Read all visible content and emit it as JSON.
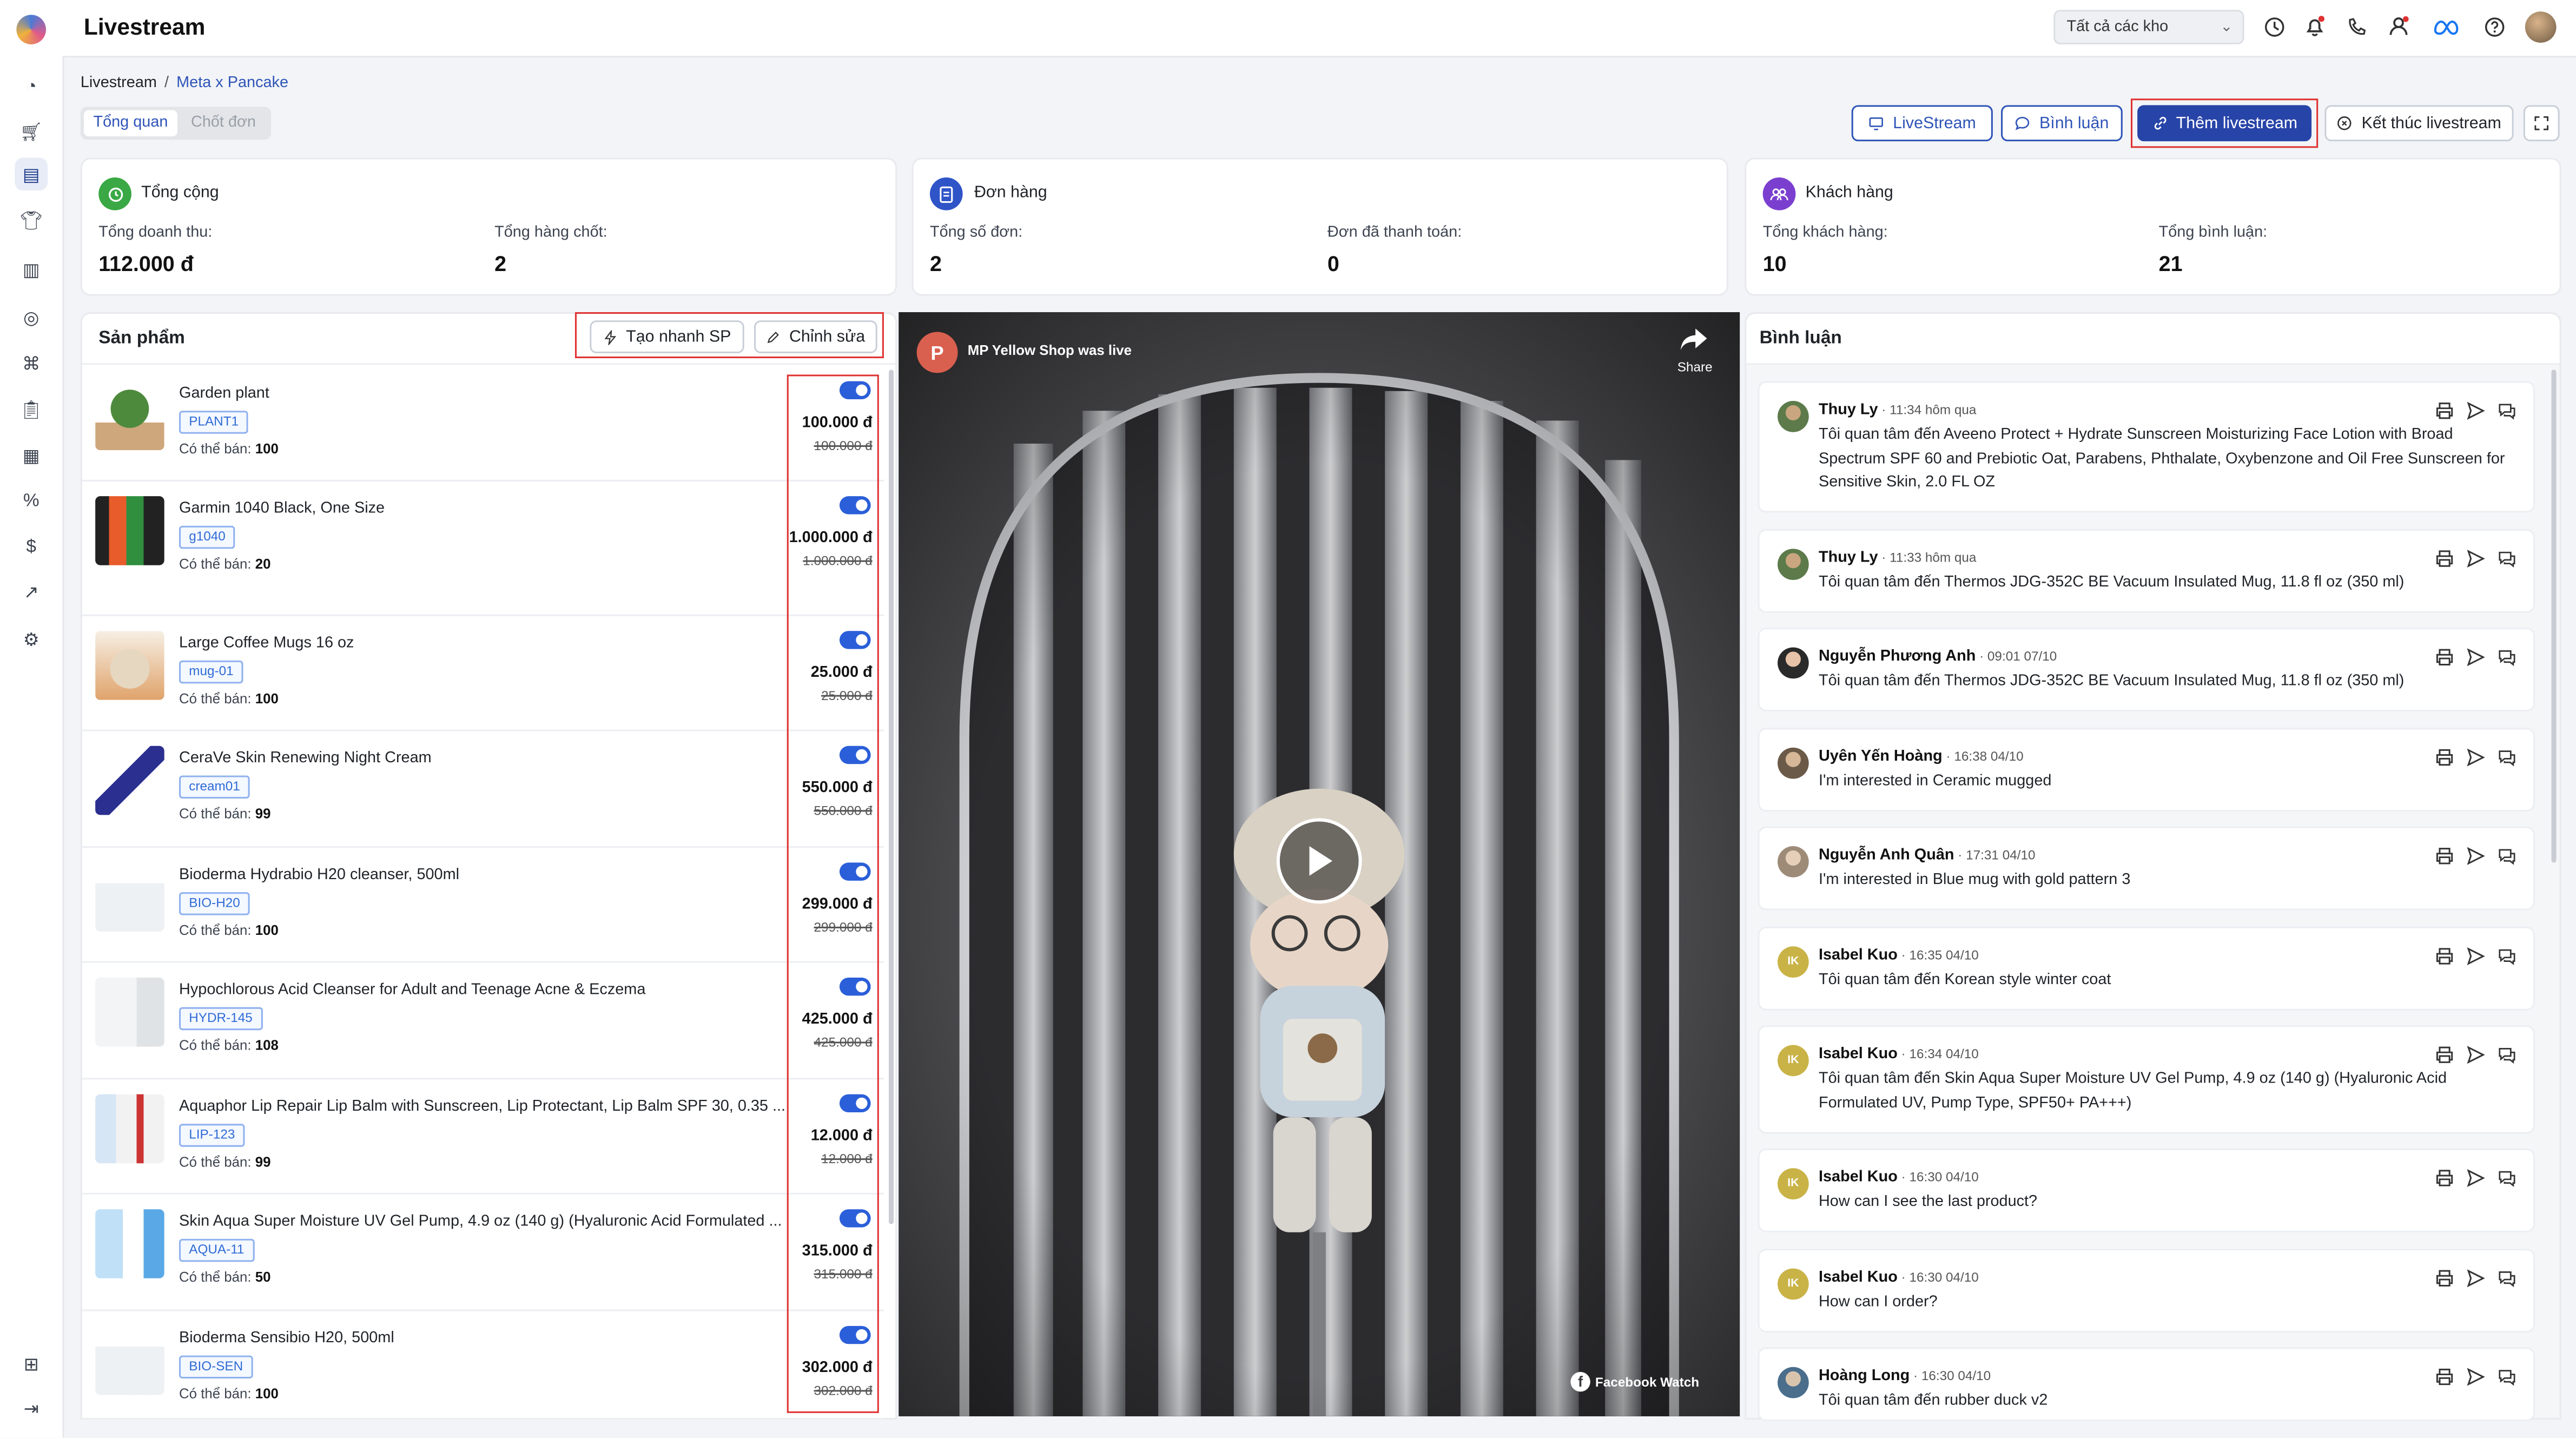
{
  "app": {
    "title": "Livestream"
  },
  "header": {
    "warehouse_select": "Tất cả các kho"
  },
  "breadcrumb": {
    "root": "Livestream",
    "separator": "/",
    "current": "Meta x Pancake"
  },
  "tabs": [
    {
      "label": "Tổng quan",
      "active": true
    },
    {
      "label": "Chốt đơn",
      "active": false
    }
  ],
  "actions": {
    "livestream": "LiveStream",
    "comments": "Bình luận",
    "add_livestream": "Thêm livestream",
    "end_livestream": "Kết thúc livestream"
  },
  "stats": {
    "total": {
      "title": "Tổng cộng",
      "revenue_label": "Tổng doanh thu:",
      "revenue_value": "112.000 đ",
      "items_label": "Tổng hàng chốt:",
      "items_value": "2"
    },
    "orders": {
      "title": "Đơn hàng",
      "count_label": "Tổng số đơn:",
      "count_value": "2",
      "paid_label": "Đơn đã thanh toán:",
      "paid_value": "0"
    },
    "customers": {
      "title": "Khách hàng",
      "count_label": "Tổng khách hàng:",
      "count_value": "10",
      "comments_label": "Tổng bình luận:",
      "comments_value": "21"
    }
  },
  "products": {
    "title": "Sản phẩm",
    "quick_create": "Tạo nhanh SP",
    "edit": "Chỉnh sửa",
    "available_label": "Có thể bán:",
    "items": [
      {
        "name": "Garden plant",
        "sku": "PLANT1",
        "available": "100",
        "price": "100.000 đ",
        "original_price": "100.000 đ",
        "enabled": true
      },
      {
        "name": "Garmin 1040 Black, One Size",
        "sku": "g1040",
        "available": "20",
        "price": "1.000.000 đ",
        "original_price": "1.000.000 đ",
        "enabled": true
      },
      {
        "name": "Large Coffee Mugs 16 oz",
        "sku": "mug-01",
        "available": "100",
        "price": "25.000 đ",
        "original_price": "25.000 đ",
        "enabled": true
      },
      {
        "name": "CeraVe Skin Renewing Night Cream",
        "sku": "cream01",
        "available": "99",
        "price": "550.000 đ",
        "original_price": "550.000 đ",
        "enabled": true
      },
      {
        "name": "Bioderma Hydrabio H20 cleanser, 500ml",
        "sku": "BIO-H20",
        "available": "100",
        "price": "299.000 đ",
        "original_price": "299.000 đ",
        "enabled": true
      },
      {
        "name": "Hypochlorous Acid Cleanser for Adult and Teenage Acne & Eczema",
        "sku": "HYDR-145",
        "available": "108",
        "price": "425.000 đ",
        "original_price": "425.000 đ",
        "enabled": true
      },
      {
        "name": "Aquaphor Lip Repair Lip Balm with Sunscreen, Lip Protectant, Lip Balm SPF 30, 0.35 ...",
        "sku": "LIP-123",
        "available": "99",
        "price": "12.000 đ",
        "original_price": "12.000 đ",
        "enabled": true
      },
      {
        "name": "Skin Aqua Super Moisture UV Gel Pump, 4.9 oz (140 g) (Hyaluronic Acid Formulated ...",
        "sku": "AQUA-11",
        "available": "50",
        "price": "315.000 đ",
        "original_price": "315.000 đ",
        "enabled": true
      },
      {
        "name": "Bioderma Sensibio H20, 500ml",
        "sku": "BIO-SEN",
        "available": "100",
        "price": "302.000 đ",
        "original_price": "302.000 đ",
        "enabled": true
      }
    ]
  },
  "video": {
    "page_initial": "P",
    "page_status": "MP Yellow Shop was live",
    "share_label": "Share",
    "watermark": "Facebook Watch"
  },
  "comments": {
    "title": "Bình luận",
    "items": [
      {
        "name": "Thuy Ly",
        "time": "11:34 hôm qua",
        "text": "Tôi quan tâm đến Aveeno Protect + Hydrate Sunscreen Moisturizing Face Lotion with Broad Spectrum SPF 60 and Prebiotic Oat, Parabens, Phthalate, Oxybenzone and Oil Free Sunscreen for Sensitive Skin, 2.0 FL OZ"
      },
      {
        "name": "Thuy Ly",
        "time": "11:33 hôm qua",
        "text": "Tôi quan tâm đến Thermos JDG-352C BE Vacuum Insulated Mug, 11.8 fl oz (350 ml)"
      },
      {
        "name": "Nguyễn Phương Anh",
        "time": "09:01 07/10",
        "text": "Tôi quan tâm đến Thermos JDG-352C BE Vacuum Insulated Mug, 11.8 fl oz (350 ml)"
      },
      {
        "name": "Uyên Yến Hoàng",
        "time": "16:38 04/10",
        "text": "I'm interested in Ceramic mugged"
      },
      {
        "name": "Nguyễn Anh Quân",
        "time": "17:31 04/10",
        "text": "I'm interested in Blue mug with gold pattern 3"
      },
      {
        "name": "Isabel Kuo",
        "time": "16:35 04/10",
        "text": "Tôi quan tâm đến Korean style winter coat",
        "initials": "IK"
      },
      {
        "name": "Isabel Kuo",
        "time": "16:34 04/10",
        "text": "Tôi quan tâm đến Skin Aqua Super Moisture UV Gel Pump, 4.9 oz (140 g) (Hyaluronic Acid Formulated UV, Pump Type, SPF50+ PA+++)",
        "initials": "IK"
      },
      {
        "name": "Isabel Kuo",
        "time": "16:30 04/10",
        "text": "How can I see the last product?",
        "initials": "IK"
      },
      {
        "name": "Isabel Kuo",
        "time": "16:30 04/10",
        "text": "How can I order?",
        "initials": "IK"
      },
      {
        "name": "Hoàng Long",
        "time": "16:30 04/10",
        "text": "Tôi quan tâm đến rubber duck v2"
      }
    ]
  },
  "colors": {
    "primary": "#2744a8",
    "accent_blue": "#2b5fd9",
    "highlight_red": "#e03131",
    "total_icon": "#3aa845",
    "orders_icon": "#2f54c8",
    "customers_icon": "#7b3fd0"
  }
}
